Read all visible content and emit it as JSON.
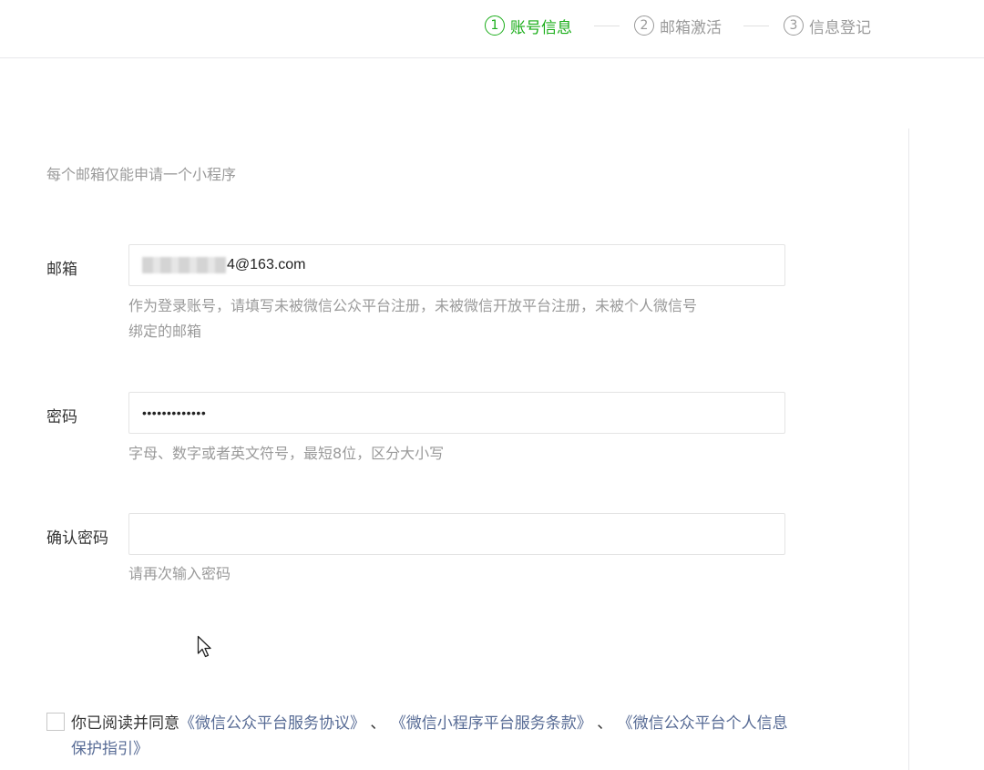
{
  "steps": [
    {
      "num": "1",
      "label": "账号信息",
      "active": true
    },
    {
      "num": "2",
      "label": "邮箱激活",
      "active": false
    },
    {
      "num": "3",
      "label": "信息登记",
      "active": false
    }
  ],
  "form": {
    "top_hint": "每个邮箱仅能申请一个小程序",
    "email": {
      "label": "邮箱",
      "value_suffix": "4@163.com",
      "tip_line1": "作为登录账号，请填写未被微信公众平台注册，未被微信开放平台注册，未被个人微信号",
      "tip_line2": "绑定的邮箱"
    },
    "password": {
      "label": "密码",
      "masked_value": "•••••••••••••",
      "tip": "字母、数字或者英文符号，最短8位，区分大小写"
    },
    "confirm": {
      "label": "确认密码",
      "value": "",
      "tip": "请再次输入密码"
    }
  },
  "agreement": {
    "checked": false,
    "prefix": "你已阅读并同意",
    "link1": "《微信公众平台服务协议》",
    "sep1": " 、",
    "link2": "《微信小程序平台服务条款》",
    "sep2": " 、",
    "link3": "《微信公众平台个人信息保护指引》"
  },
  "colors": {
    "active_step": "#1aad19",
    "inactive": "#9a9a9a",
    "link": "#576b95"
  }
}
